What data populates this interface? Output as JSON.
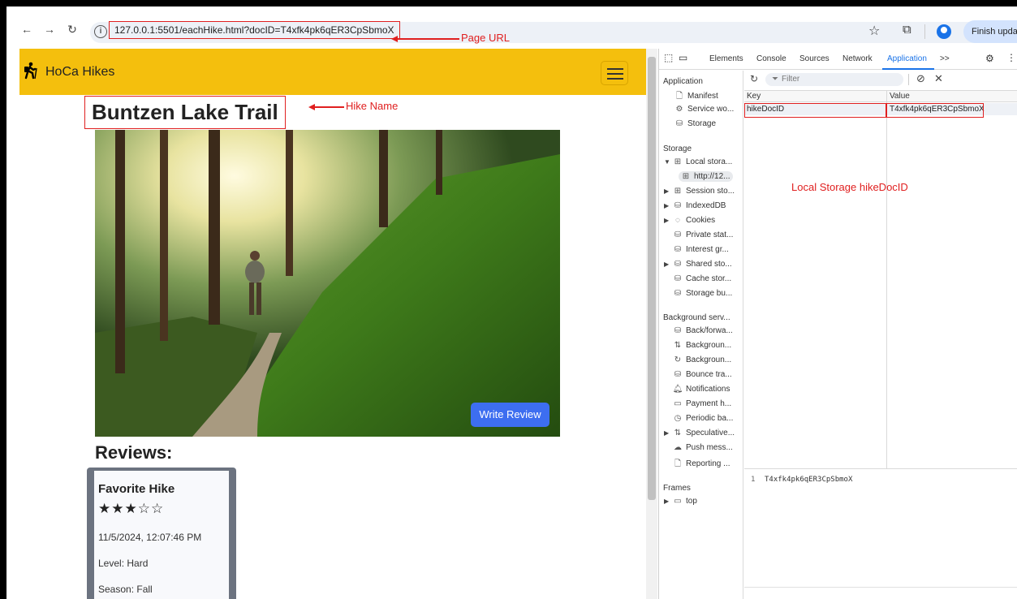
{
  "browser": {
    "url": "127.0.0.1:5501/eachHike.html?docID=T4xfk4pk6qER3CpSbmoX",
    "finish_update": "Finish update"
  },
  "annotations": {
    "page_url": "Page URL",
    "hike_name": "Hike Name",
    "local_storage": "Local Storage hikeDocID"
  },
  "site": {
    "brand": "HoCa Hikes",
    "hike_title": "Buntzen Lake Trail",
    "write_review": "Write Review",
    "reviews_heading": "Reviews:",
    "review": {
      "title": "Favorite Hike",
      "stars": "★★★☆☆",
      "date": "11/5/2024, 12:07:46 PM",
      "level": "Level: Hard",
      "season": "Season: Fall"
    }
  },
  "devtools": {
    "tabs": [
      "Elements",
      "Console",
      "Sources",
      "Network",
      "Application",
      ">>"
    ],
    "filter_placeholder": "Filter",
    "sections": {
      "application": "Application",
      "storage": "Storage",
      "background": "Background serv...",
      "frames": "Frames"
    },
    "app_items": [
      "Manifest",
      "Service wo...",
      "Storage"
    ],
    "storage_items": [
      "Local stora...",
      "http://12...",
      "Session sto...",
      "IndexedDB",
      "Cookies",
      "Private stat...",
      "Interest gr...",
      "Shared sto...",
      "Cache stor...",
      "Storage bu..."
    ],
    "background_items": [
      "Back/forwa...",
      "Backgroun...",
      "Backgroun...",
      "Bounce tra...",
      "Notifications",
      "Payment h...",
      "Periodic ba...",
      "Speculative...",
      "Push mess...",
      "Reporting ..."
    ],
    "frames_items": [
      "top"
    ],
    "table": {
      "key_header": "Key",
      "value_header": "Value",
      "key": "hikeDocID",
      "value": "T4xfk4pk6qER3CpSbmoX"
    },
    "preview": {
      "line_number": "1",
      "text": "T4xfk4pk6qER3CpSbmoX"
    }
  }
}
